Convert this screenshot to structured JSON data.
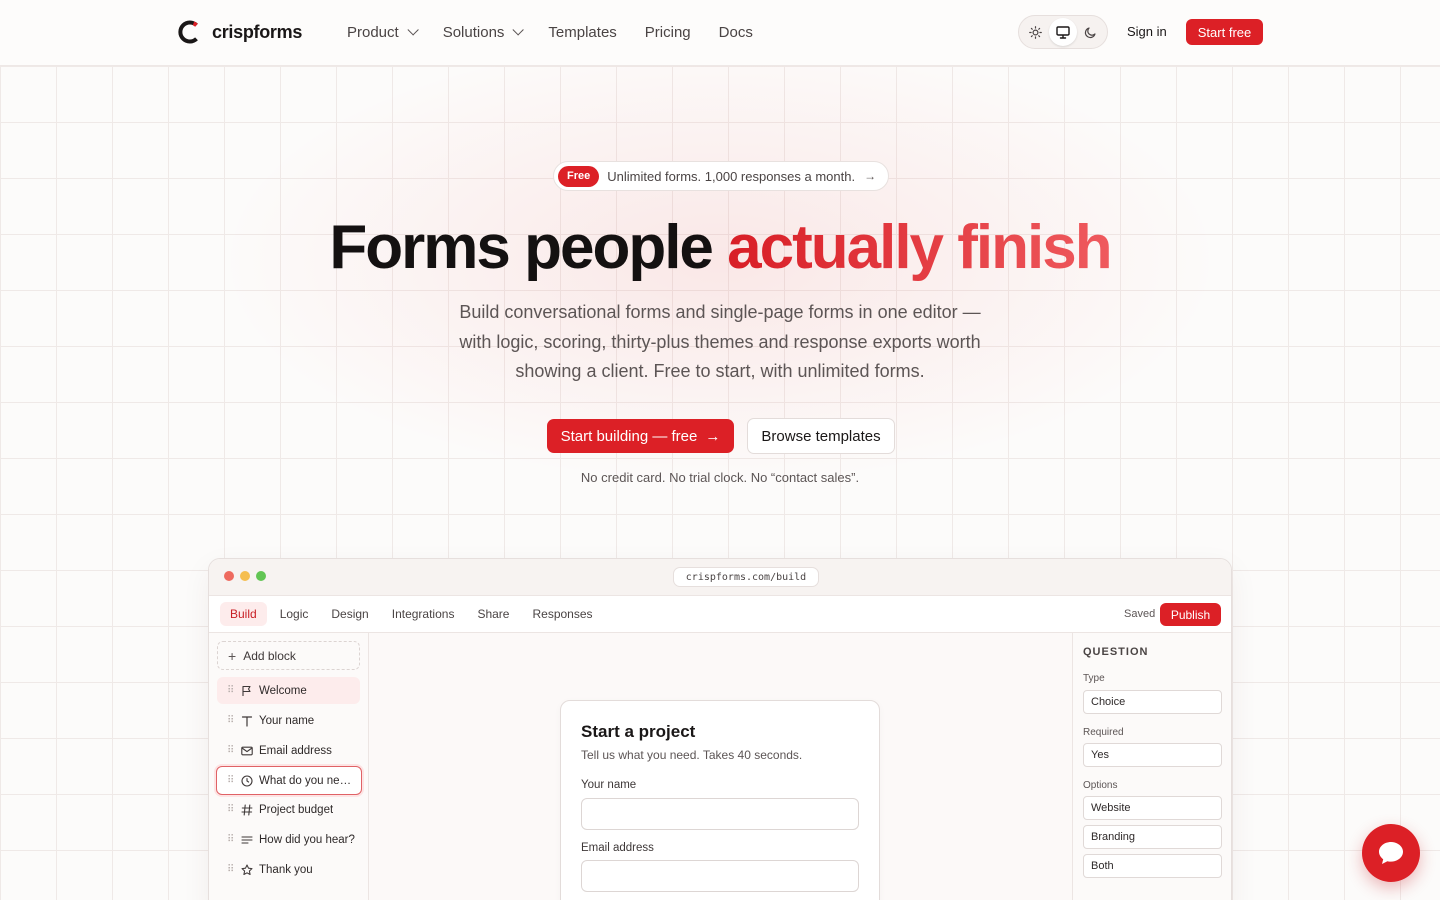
{
  "brand": {
    "name": "crispforms",
    "accent": "#dc2026"
  },
  "nav": [
    {
      "label": "Product",
      "dropdown": true
    },
    {
      "label": "Solutions",
      "dropdown": true
    },
    {
      "label": "Templates",
      "dropdown": false
    },
    {
      "label": "Pricing",
      "dropdown": false
    },
    {
      "label": "Docs",
      "dropdown": false
    }
  ],
  "theme": {
    "options": [
      "sun-icon",
      "monitor-icon",
      "moon-icon"
    ],
    "selected": "monitor-icon"
  },
  "header": {
    "signin_label": "Sign in",
    "start_label": "Start free"
  },
  "hero": {
    "badge": "Free",
    "pill_text": "Unlimited forms. 1,000 responses a month.",
    "title_plain": "Forms people",
    "title_accent": "actually finish",
    "subtitle_line1": "Build conversational forms and single-page forms in one editor —",
    "subtitle_line2": "with logic, scoring, thirty-plus themes and response exports worth",
    "subtitle_line3": "showing a client. Free to start, with unlimited forms.",
    "cta_primary": "Start building — free",
    "cta_secondary": "Browse templates",
    "note": "No credit card. No trial clock. No “contact sales”."
  },
  "app": {
    "url": "crispforms.com/build",
    "tabs": [
      "Build",
      "Logic",
      "Design",
      "Integrations",
      "Share",
      "Responses"
    ],
    "active_tab": "Build",
    "saved_label": "Saved",
    "publish_label": "Publish",
    "add_block_label": "Add block",
    "blocks": [
      {
        "label": "Welcome",
        "icon": "flag-icon"
      },
      {
        "label": "Your name",
        "icon": "text-icon"
      },
      {
        "label": "Email address",
        "icon": "mail-icon"
      },
      {
        "label": "What do you need?",
        "icon": "choice-icon"
      },
      {
        "label": "Project budget",
        "icon": "hash-icon"
      },
      {
        "label": "How did you hear?",
        "icon": "lines-icon"
      },
      {
        "label": "Thank you",
        "icon": "star-icon"
      }
    ],
    "form": {
      "title": "Start a project",
      "subtitle": "Tell us what you need. Takes 40 seconds.",
      "field1_label": "Your name",
      "field2_label": "Email address"
    },
    "inspector": {
      "heading": "QUESTION",
      "type_label": "Type",
      "type_value": "Choice",
      "required_label": "Required",
      "required_value": "Yes",
      "options_label": "Options",
      "options": [
        "Website",
        "Branding",
        "Both"
      ]
    }
  }
}
